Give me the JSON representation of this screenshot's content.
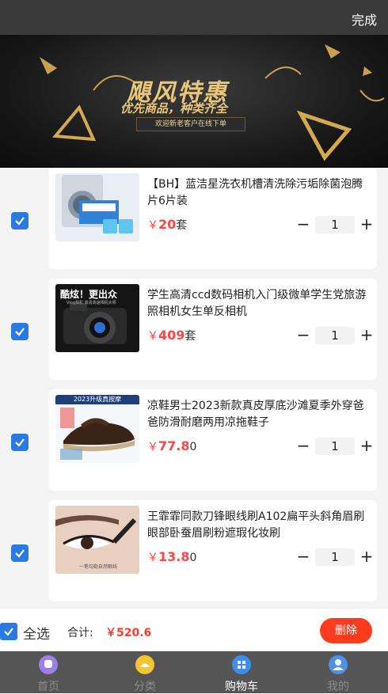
{
  "header": {
    "done_label": "完成"
  },
  "banner": {
    "title": "飓风特惠",
    "subtitle": "优先商品，种类齐全",
    "pill": "欢迎新老客户在线下单"
  },
  "items": [
    {
      "name": "【BH】蓝洁星洗衣机槽清洗除污垢除菌泡腾片6片装",
      "currency": "￥",
      "price": "20",
      "unit": "套",
      "qty": "1",
      "checked": true
    },
    {
      "name": "学生高清ccd数码相机入门级微单学生党旅游照相机女生单反相机",
      "currency": "￥",
      "price": "409",
      "unit": "套",
      "qty": "1",
      "checked": true
    },
    {
      "name": "凉鞋男士2023新款真皮厚底沙滩夏季外穿爸爸防滑耐磨两用凉拖鞋子",
      "currency": "￥",
      "price": "77.8",
      "unit": "0",
      "qty": "1",
      "checked": true
    },
    {
      "name": "王霏霏同款刀锋眼线刷A102扁平头斜角眉刷眼部卧蚕眉刷粉遮瑕化妆刷",
      "currency": "￥",
      "price": "13.8",
      "unit": "0",
      "qty": "1",
      "checked": true
    }
  ],
  "thumb_text": {
    "camera_headline": "酷炫！更出众",
    "camera_sub": "Vlog相机 高清高速相机大师",
    "sandal_headline": "2023升级真按摩",
    "brush_caption": "一笔勾勒自然眼线"
  },
  "footer": {
    "select_all": "全选",
    "total_label": "合计:",
    "total_amount": "￥520.6",
    "delete_label": "删除"
  },
  "tabs": [
    {
      "label": "首页",
      "icon": "home-icon",
      "color": "#9b7ee8"
    },
    {
      "label": "分类",
      "icon": "category-icon",
      "color": "#f5c431"
    },
    {
      "label": "购物车",
      "icon": "cart-icon",
      "color": "#3d8df0"
    },
    {
      "label": "我的",
      "icon": "profile-icon",
      "color": "#4a93e8"
    }
  ],
  "colors": {
    "accent": "#2a7ae2",
    "price": "#ff4545",
    "delete": "#ff3b1f",
    "tabbar": "#555555"
  }
}
